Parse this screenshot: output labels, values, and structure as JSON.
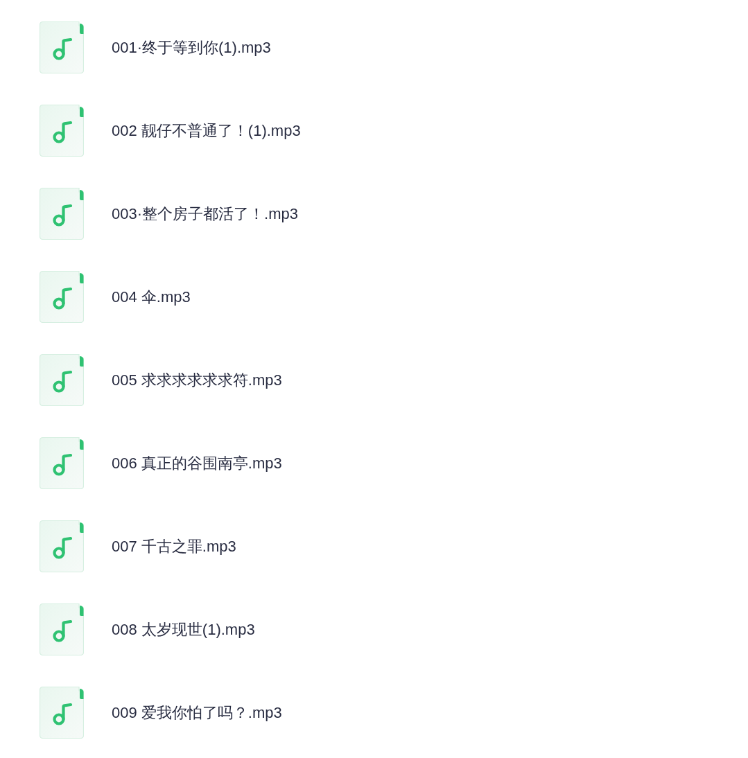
{
  "files": [
    {
      "name": "001·终于等到你(1).mp3"
    },
    {
      "name": "002 靓仔不普通了！(1).mp3"
    },
    {
      "name": "003·整个房子都活了！.mp3"
    },
    {
      "name": "004 伞.mp3"
    },
    {
      "name": "005 求求求求求求符.mp3"
    },
    {
      "name": "006 真正的谷围南亭.mp3"
    },
    {
      "name": "007 千古之罪.mp3"
    },
    {
      "name": "008 太岁现世(1).mp3"
    },
    {
      "name": "009 爱我你怕了吗？.mp3"
    }
  ]
}
